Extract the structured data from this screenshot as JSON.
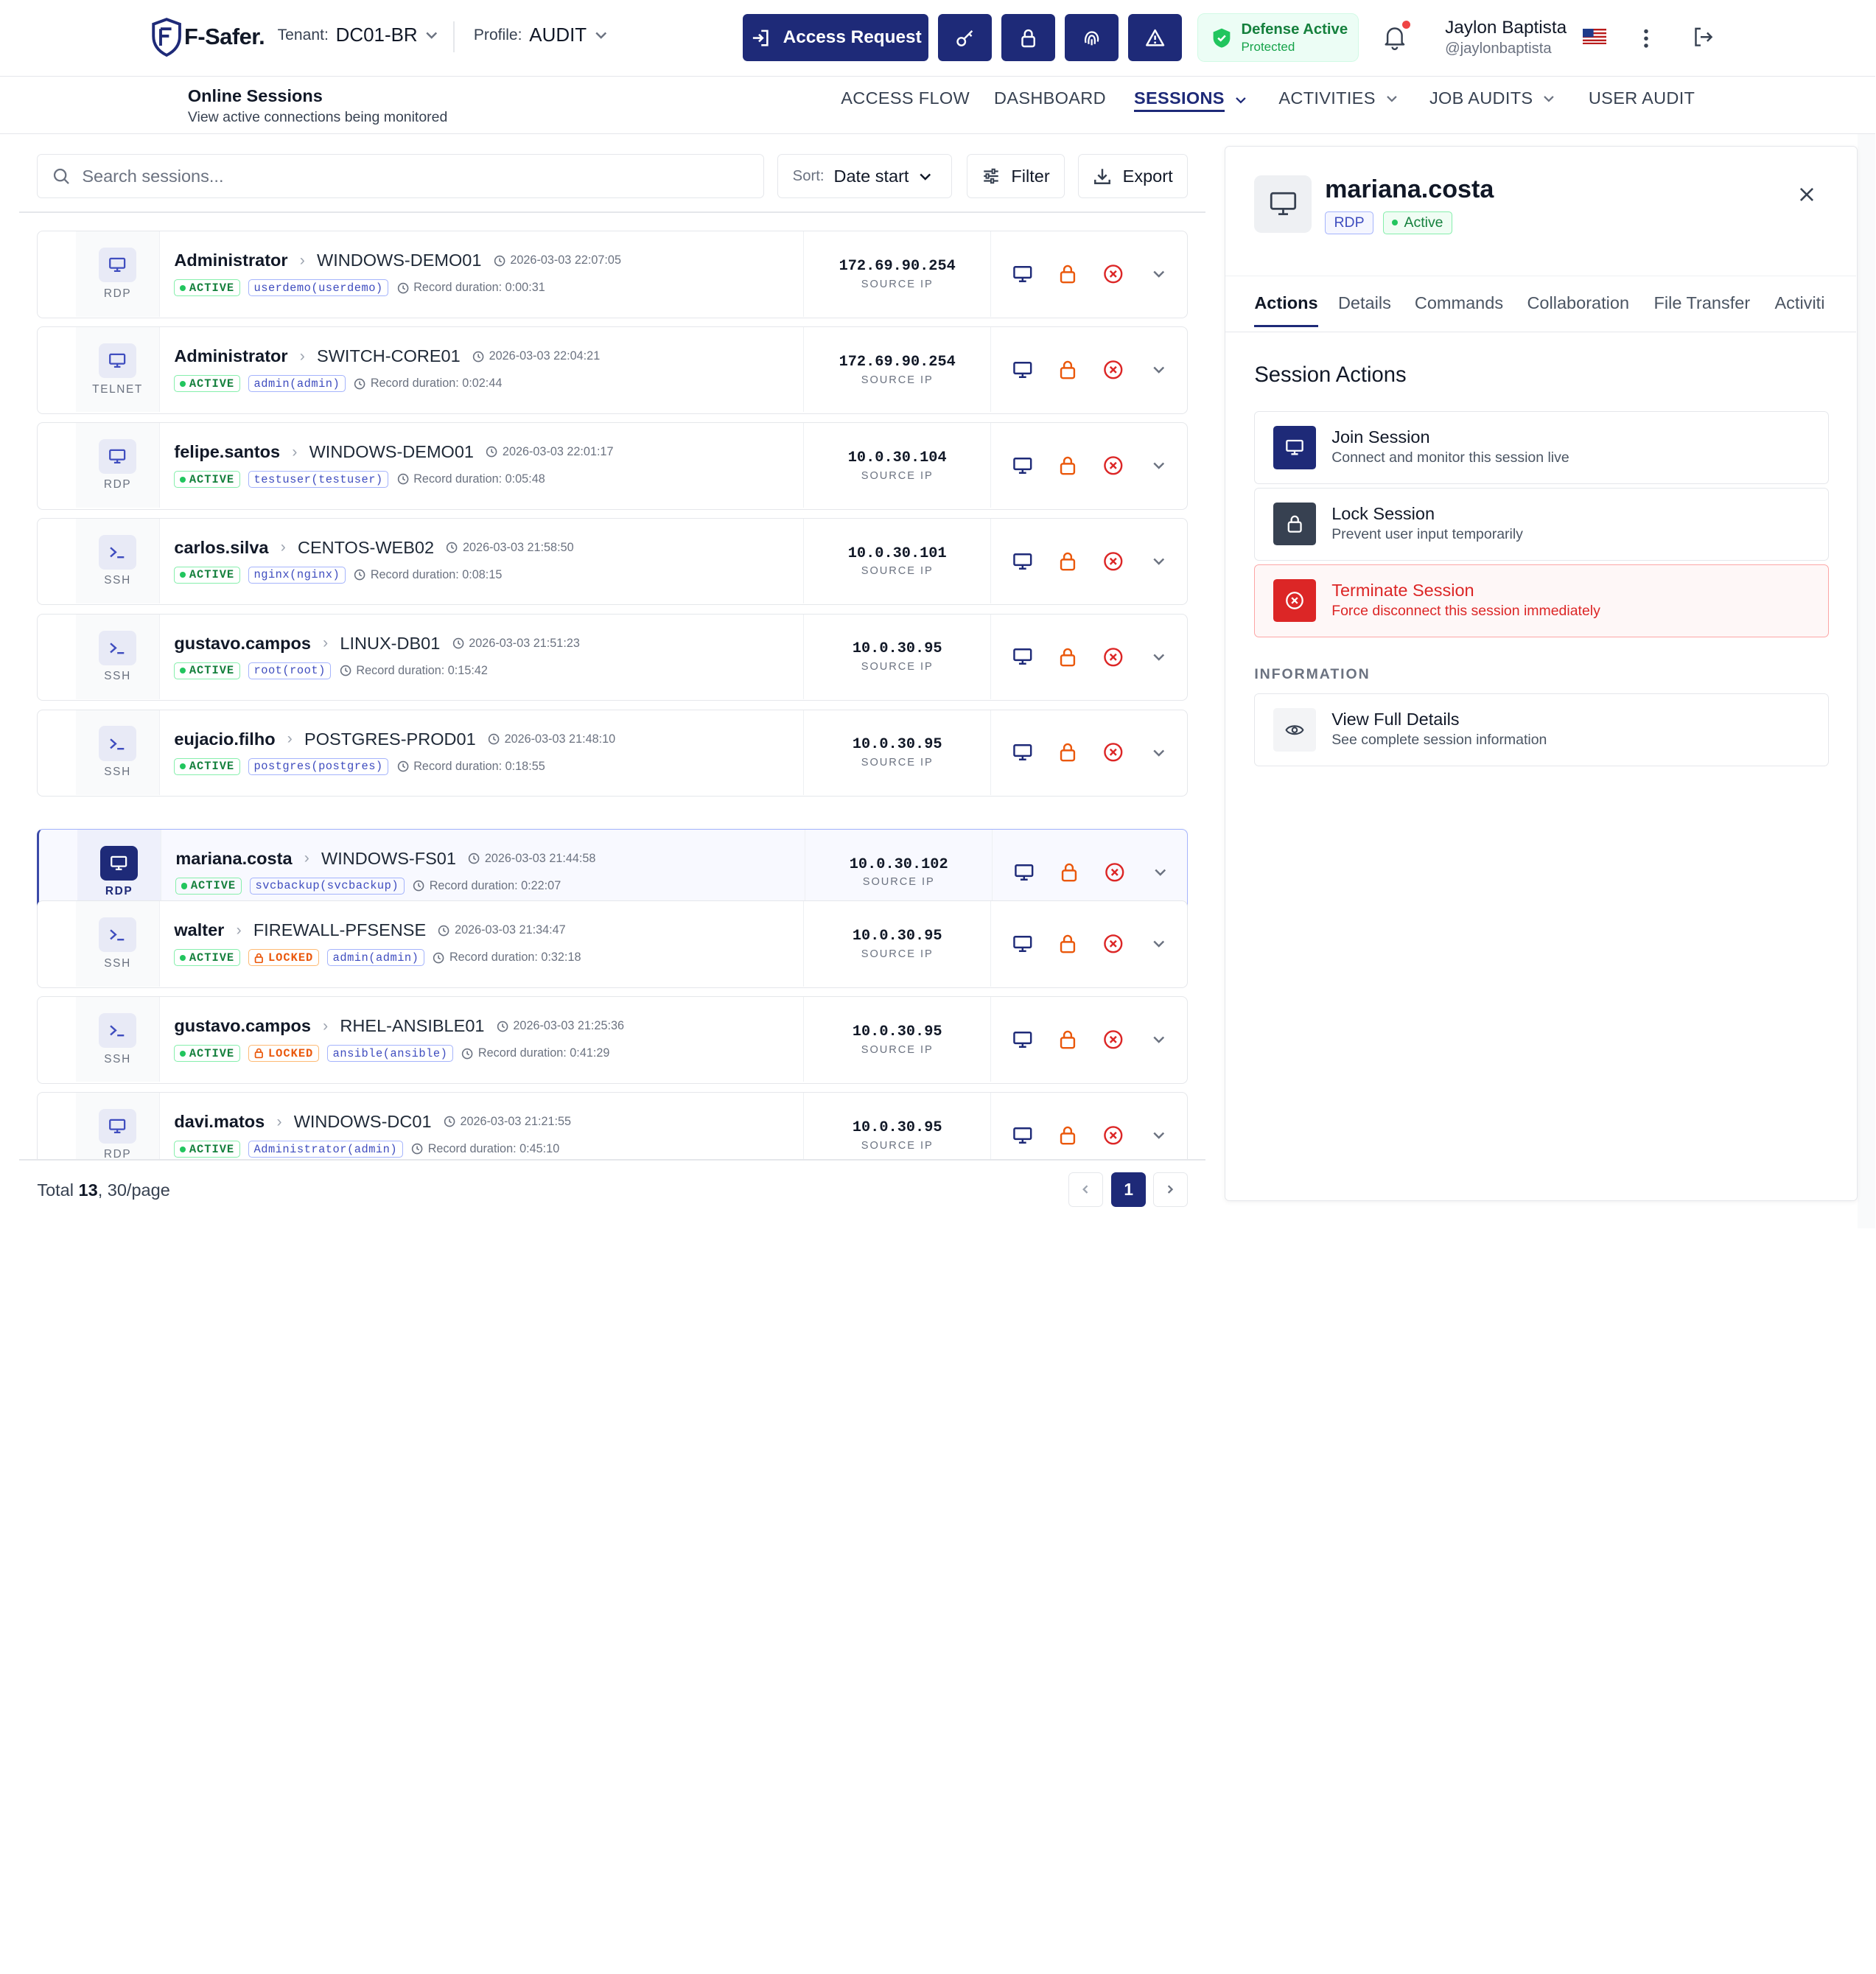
{
  "header": {
    "logo_text": "F-Safer.",
    "tenant_label": "Tenant:",
    "tenant_value": "DC01-BR",
    "profile_label": "Profile:",
    "profile_value": "AUDIT",
    "access_request_label": "Access Request",
    "icon_buttons": [
      "key-icon",
      "lock-icon",
      "fingerprint-icon",
      "warning-icon"
    ],
    "defense_title": "Defense Active",
    "defense_sub": "Protected",
    "user_name": "Jaylon Baptista",
    "user_handle": "@jaylonbaptista",
    "accent": "#1e2a78"
  },
  "page": {
    "title": "Online Sessions",
    "subtitle": "View active connections being monitored"
  },
  "nav": {
    "items": [
      "ACCESS FLOW",
      "DASHBOARD",
      "SESSIONS",
      "ACTIVITIES",
      "JOB AUDITS",
      "USER AUDIT"
    ],
    "active": "SESSIONS"
  },
  "toolbar": {
    "search_placeholder": "Search sessions...",
    "sort_label": "Sort:",
    "sort_value": "Date start",
    "filter_label": "Filter",
    "export_label": "Export"
  },
  "sessions": [
    {
      "type": "RDP",
      "user": "Administrator",
      "host": "WINDOWS-DEMO01",
      "start": "2026-03-03 22:07:05",
      "status": "ACTIVE",
      "locked": false,
      "account": "userdemo(userdemo)",
      "duration": "Record duration: 0:00:31",
      "ip": "172.69.90.254"
    },
    {
      "type": "TELNET",
      "user": "Administrator",
      "host": "SWITCH-CORE01",
      "start": "2026-03-03 22:04:21",
      "status": "ACTIVE",
      "locked": false,
      "account": "admin(admin)",
      "duration": "Record duration: 0:02:44",
      "ip": "172.69.90.254"
    },
    {
      "type": "RDP",
      "user": "felipe.santos",
      "host": "WINDOWS-DEMO01",
      "start": "2026-03-03 22:01:17",
      "status": "ACTIVE",
      "locked": false,
      "account": "testuser(testuser)",
      "duration": "Record duration: 0:05:48",
      "ip": "10.0.30.104"
    },
    {
      "type": "SSH",
      "user": "carlos.silva",
      "host": "CENTOS-WEB02",
      "start": "2026-03-03 21:58:50",
      "status": "ACTIVE",
      "locked": false,
      "account": "nginx(nginx)",
      "duration": "Record duration: 0:08:15",
      "ip": "10.0.30.101"
    },
    {
      "type": "SSH",
      "user": "gustavo.campos",
      "host": "LINUX-DB01",
      "start": "2026-03-03 21:51:23",
      "status": "ACTIVE",
      "locked": false,
      "account": "root(root)",
      "duration": "Record duration: 0:15:42",
      "ip": "10.0.30.95"
    },
    {
      "type": "SSH",
      "user": "eujacio.filho",
      "host": "POSTGRES-PROD01",
      "start": "2026-03-03 21:48:10",
      "status": "ACTIVE",
      "locked": false,
      "account": "postgres(postgres)",
      "duration": "Record duration: 0:18:55",
      "ip": "10.0.30.95"
    },
    {
      "type": "RDP",
      "user": "mariana.costa",
      "host": "WINDOWS-FS01",
      "start": "2026-03-03 21:44:58",
      "status": "ACTIVE",
      "locked": false,
      "account": "svcbackup(svcbackup)",
      "duration": "Record duration: 0:22:07",
      "ip": "10.0.30.102",
      "selected": true
    },
    {
      "type": "SSH",
      "user": "walter",
      "host": "FIREWALL-PFSENSE",
      "start": "2026-03-03 21:34:47",
      "status": "ACTIVE",
      "locked": true,
      "account": "admin(admin)",
      "duration": "Record duration: 0:32:18",
      "ip": "10.0.30.95"
    },
    {
      "type": "SSH",
      "user": "gustavo.campos",
      "host": "RHEL-ANSIBLE01",
      "start": "2026-03-03 21:25:36",
      "status": "ACTIVE",
      "locked": true,
      "account": "ansible(ansible)",
      "duration": "Record duration: 0:41:29",
      "ip": "10.0.30.95"
    },
    {
      "type": "RDP",
      "user": "davi.matos",
      "host": "WINDOWS-DC01",
      "start": "2026-03-03 21:21:55",
      "status": "ACTIVE",
      "locked": false,
      "account": "Administrator(admin)",
      "duration": "Record duration: 0:45:10",
      "ip": "10.0.30.95"
    }
  ],
  "labels": {
    "source_ip": "SOURCE IP",
    "active": "ACTIVE",
    "locked": "LOCKED"
  },
  "footer": {
    "total_prefix": "Total",
    "total_count": "13",
    "per_page": ", 30/page",
    "current_page": "1"
  },
  "panel": {
    "title": "mariana.costa",
    "type_badge": "RDP",
    "status_badge": "Active",
    "tabs": [
      "Actions",
      "Details",
      "Commands",
      "Collaboration",
      "File Transfer",
      "Activiti"
    ],
    "active_tab": "Actions",
    "section_title": "Session Actions",
    "actions": [
      {
        "title": "Join Session",
        "desc": "Connect and monitor this session live",
        "icon": "monitor-icon",
        "color": "#1e2a78"
      },
      {
        "title": "Lock Session",
        "desc": "Prevent user input temporarily",
        "icon": "lock-icon",
        "color": "#374151"
      },
      {
        "title": "Terminate Session",
        "desc": "Force disconnect this session immediately",
        "icon": "terminate-icon",
        "color": "#dc2626"
      }
    ],
    "info_label": "INFORMATION",
    "info_card_title": "View Full Details",
    "info_card_desc": "See complete session information"
  }
}
